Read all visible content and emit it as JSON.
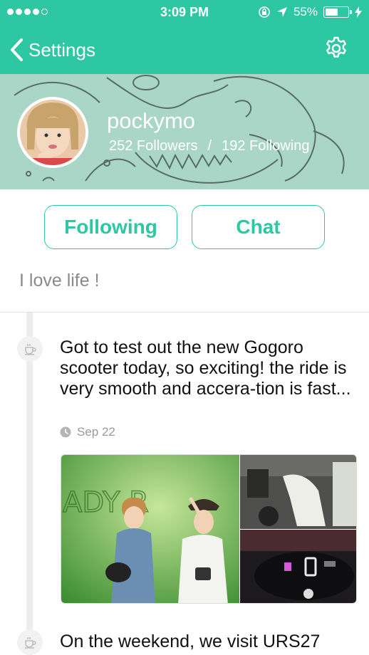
{
  "status_bar": {
    "time": "3:09 PM",
    "battery_percent": "55%",
    "battery_level": 0.55,
    "signal_bars_filled": 4,
    "signal_bars_total": 5
  },
  "nav": {
    "back_label": "Settings"
  },
  "profile": {
    "username": "pockymo",
    "followers": "252 Followers",
    "separator": "/",
    "following": "192 Following",
    "bio": "I love life !"
  },
  "actions": {
    "following_label": "Following",
    "chat_label": "Chat"
  },
  "posts": [
    {
      "text": "Got to test out the new Gogoro scooter today, so exciting! the ride is very smooth and accera-tion is fast...",
      "date": "Sep 22",
      "photo_sign_text": "ADY R"
    },
    {
      "text": "On the weekend, we visit URS27"
    }
  ],
  "colors": {
    "accent": "#2dc8a3",
    "header_bg": "#a9d6c6",
    "muted_text": "#8a8a8a"
  },
  "icons": {
    "back": "chevron-left-icon",
    "settings": "gear-icon",
    "timeline_node": "cup-icon",
    "date": "clock-icon"
  }
}
